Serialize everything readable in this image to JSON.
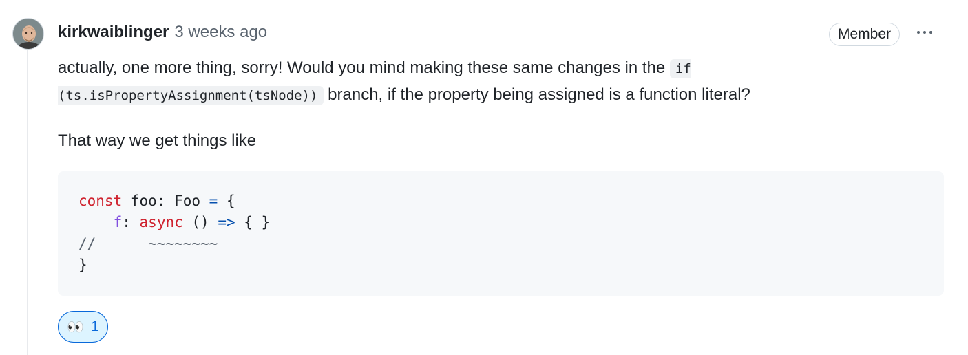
{
  "comment": {
    "author": "kirkwaiblinger",
    "timestamp": "3 weeks ago",
    "badge": "Member",
    "body": {
      "p1_before": "actually, one more thing, sorry! Would you mind making these same changes in the ",
      "p1_code": "if (ts.isPropertyAssignment(tsNode))",
      "p1_after": " branch, if the property being assigned is a function literal?",
      "p2": "That way we get things like"
    },
    "code_block": {
      "line1": {
        "kw": "const",
        "mid": " foo: Foo ",
        "op": "=",
        "end": " {"
      },
      "line2": {
        "indent": "    ",
        "prop": "f",
        "colon": ": ",
        "kw": "async",
        "mid": " () ",
        "op": "=>",
        "end": " { }"
      },
      "line3": {
        "comment": "//",
        "squiggle": "~~~~~~~~"
      },
      "line4": "}"
    },
    "reaction": {
      "emoji": "👀",
      "icon": "eyes-icon",
      "count": "1"
    }
  },
  "colors": {
    "keyword": "#cf222e",
    "property": "#8250df",
    "operator": "#0550ae",
    "reaction_border": "#0969da",
    "reaction_bg": "#ddf4ff"
  }
}
